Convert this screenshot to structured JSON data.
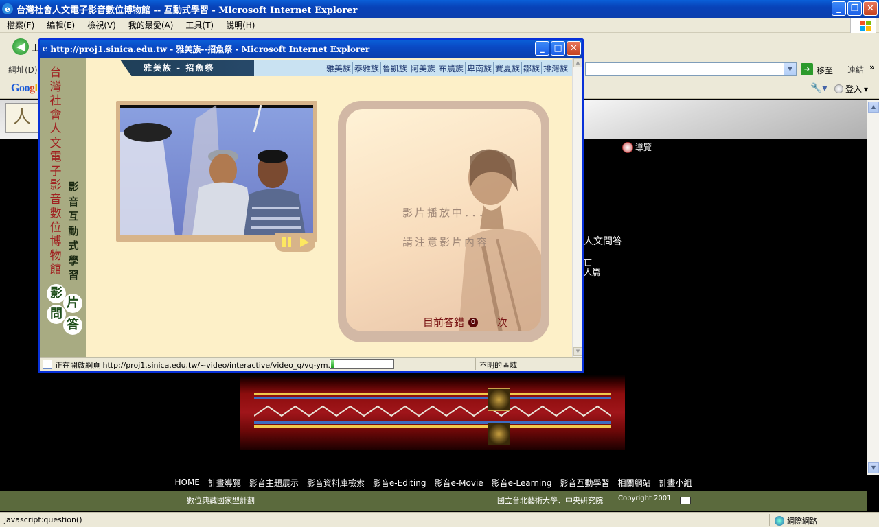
{
  "browser": {
    "title": "台灣社會人文電子影音數位博物館 -- 互動式學習 - Microsoft Internet Explorer",
    "menu": [
      "檔案(F)",
      "編輯(E)",
      "檢視(V)",
      "我的最愛(A)",
      "工具(T)",
      "說明(H)"
    ],
    "back_label": "上",
    "address_label": "網址(D)",
    "go_label": "移至",
    "links_label": "連結",
    "links_chevron": "»",
    "google_logo": [
      "Goo",
      "g",
      "l",
      "e"
    ],
    "login_label": "登入",
    "status_text": "javascript:question()",
    "zone_label": "網際網路"
  },
  "page": {
    "guide_label": "導覽",
    "side_text_1": "人文問答",
    "side_text_2": "匸",
    "side_text_3": "人篇",
    "footer_nav": [
      "HOME",
      "計畫導覽",
      "影音主題展示",
      "影音資料庫檢索",
      "影音e-Editing",
      "影音e-Movie",
      "影音e-Learning",
      "影音互動學習",
      "相關網站",
      "計畫小組"
    ],
    "footer_left": "數位典藏國家型計劃",
    "footer_right": "國立台北藝術大學．中央研究院",
    "copyright": "Copyright 2001"
  },
  "popup": {
    "title": "http://proj1.sinica.edu.tw - 雅美族--招魚祭 - Microsoft Internet Explorer",
    "side_title": "台灣社會人文電子影音數位博物館",
    "side_subtitle": "影音互動式學習",
    "qa_chars": [
      "影",
      "片",
      "問",
      "答"
    ],
    "header_title": "雅美族 - 招魚祭",
    "tribes": [
      "雅美族",
      "泰雅族",
      "魯凱族",
      "阿美族",
      "布農族",
      "卑南族",
      "賽夏族",
      "鄒族",
      "排灣族"
    ],
    "message_1": "影片播放中．．．",
    "message_2": "請注意影片內容",
    "wrong_label": "目前答錯",
    "wrong_count": "0",
    "times_label": "次",
    "status_text": "正在開啟網頁 http://proj1.sinica.edu.tw/~video/interactive/video_q/vq-ym.html...",
    "progress": 0.06,
    "zone_label": "不明的區域"
  },
  "colors": {
    "xp_blue": "#0a49c4",
    "chrome": "#ece9d8",
    "popup_bg": "#fdf0c8",
    "tribe_link": "#1f3870",
    "wrong_red": "#7a1515",
    "footer_green": "#5b6a3d"
  }
}
